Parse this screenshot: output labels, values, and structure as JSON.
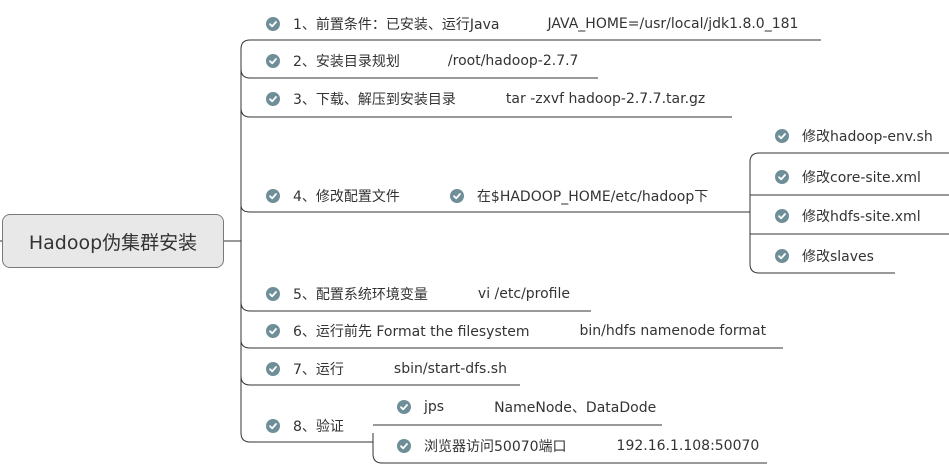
{
  "root": {
    "label": "Hadoop伪集群安装"
  },
  "steps": [
    {
      "label": "1、前置条件：已安装、运行Java",
      "detail": "JAVA_HOME=/usr/local/jdk1.8.0_181"
    },
    {
      "label": "2、安装目录规划",
      "detail": "/root/hadoop-2.7.7"
    },
    {
      "label": "3、下载、解压到安装目录",
      "detail": "tar  -zxvf   hadoop-2.7.7.tar.gz"
    },
    {
      "label": "4、修改配置文件"
    },
    {
      "label": "5、配置系统环境变量",
      "detail": "vi  /etc/profile"
    },
    {
      "label": "6、运行前先 Format the filesystem",
      "detail": "bin/hdfs namenode format"
    },
    {
      "label": "7、运行",
      "detail": "sbin/start-dfs.sh"
    },
    {
      "label": "8、验证"
    }
  ],
  "config": {
    "location": "在$HADOOP_HOME/etc/hadoop下",
    "files": [
      "修改hadoop-env.sh",
      "修改core-site.xml",
      "修改hdfs-site.xml",
      "修改slaves"
    ]
  },
  "verify": [
    {
      "label": "jps",
      "detail": "NameNode、DataDode"
    },
    {
      "label": "浏览器访问50070端口",
      "detail": "192.16.1.108:50070"
    }
  ],
  "colors": {
    "line": "#333333",
    "check_fill": "#6f8f98",
    "root_fill": "#e8e8e8",
    "root_border": "#7a7a7a",
    "text": "#333333"
  }
}
